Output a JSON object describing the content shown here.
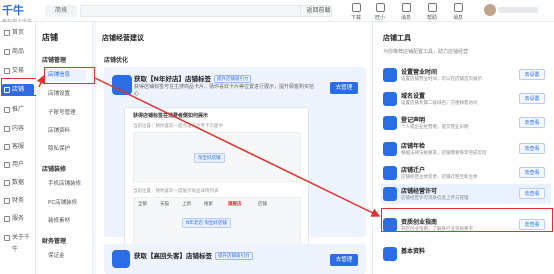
{
  "topbar": {
    "logo_text": "千牛",
    "logo_sub": "卖在淘上千牛",
    "shop_select": "简境",
    "search_button": "返回前载",
    "tools": [
      {
        "icon": "download-icon",
        "label": "下载"
      },
      {
        "icon": "wangwang-icon",
        "label": "旺小"
      },
      {
        "icon": "apps-icon",
        "label": "消息"
      },
      {
        "icon": "help-icon",
        "label": "帮助"
      },
      {
        "icon": "message-icon",
        "label": "消息"
      }
    ]
  },
  "side1": [
    {
      "icon": "home-icon",
      "label": "首页"
    },
    {
      "icon": "goods-icon",
      "label": "商品"
    },
    {
      "icon": "trade-icon",
      "label": "交易"
    },
    {
      "icon": "shop-icon",
      "label": "店铺",
      "active": true
    },
    {
      "icon": "promote-icon",
      "label": "推广"
    },
    {
      "icon": "content-icon",
      "label": "内容"
    },
    {
      "icon": "customer-icon",
      "label": "客服"
    },
    {
      "icon": "user-icon",
      "label": "用户"
    },
    {
      "icon": "data-icon",
      "label": "数据"
    },
    {
      "icon": "finance-icon",
      "label": "财务"
    },
    {
      "icon": "services-icon",
      "label": "服务"
    },
    {
      "icon": "more-icon",
      "label": "关于千牛"
    }
  ],
  "side2": {
    "title": "店铺",
    "groups": [
      {
        "label": "店铺管理",
        "items": [
          "店铺信息",
          "店铺设置",
          "子账号管理",
          "店铺资料",
          "隐私保护"
        ]
      },
      {
        "label": "店铺装修",
        "items": [
          "手机店铺装修",
          "PC店铺装修",
          "装修素材"
        ]
      },
      {
        "label": "财务管理",
        "items": [
          "保证金"
        ]
      }
    ],
    "active_item": "店铺信息"
  },
  "main": {
    "title": "店铺经营建议",
    "section": "店铺优化",
    "card1": {
      "title": "获取【N年好店】店铺标签",
      "tag": "提升店铺吸引力",
      "desc": "获得店铺标签可在主搜商品卡片、猜你喜欢卡片等位置进行展示，提升顾客购买信心",
      "button": "去管理"
    },
    "preview": {
      "title": "获得店铺标签在消费者侧如何展示",
      "line1": "当前位置：猜你喜欢一度点击商品专卡页面中",
      "tag1": "淘宝好店铺",
      "line2": "当前位置：猜你喜欢一度展示商品详情列表",
      "tabs": [
        "全部",
        "天猫",
        "上新",
        "搜索",
        "旗舰店",
        "店铺"
      ],
      "tag2": "N年老店 淘宝好店铺"
    },
    "card2": {
      "title": "获取【高回头客】店铺标签",
      "tag": "提升店铺吸引力",
      "button": "去管理"
    }
  },
  "right": {
    "title": "店铺工具",
    "subtitle": "为你推荐店铺配置工具，助力店铺经营",
    "items": [
      {
        "name": "设置营业时间",
        "desc": "设置店铺营业时间，可以在店铺首页展示",
        "button": "去设置"
      },
      {
        "name": "域名设置",
        "desc": "设置店铺专属二级域名，方便顾客访问",
        "button": "去设置"
      },
      {
        "name": "登记声明",
        "desc": "个人或企业经营者，提交营业声明",
        "button": "去查看"
      },
      {
        "name": "店铺年检",
        "desc": "根据法律法规要求，店铺需要每年完成年检",
        "button": "去查看"
      },
      {
        "name": "店铺迁户",
        "desc": "店铺经营主体变更，店铺迁移至新主体",
        "button": "去查看"
      },
      {
        "name": "店铺经营许可",
        "desc": "店铺经营许可资质信息上传与管理",
        "button": "去查看",
        "selected": true
      },
      {
        "name": "资质创业指南",
        "desc": "开店创业指南，了解各行业资质要求",
        "button": "去查看"
      },
      {
        "name": "基本资料",
        "desc": "",
        "button": ""
      }
    ]
  }
}
